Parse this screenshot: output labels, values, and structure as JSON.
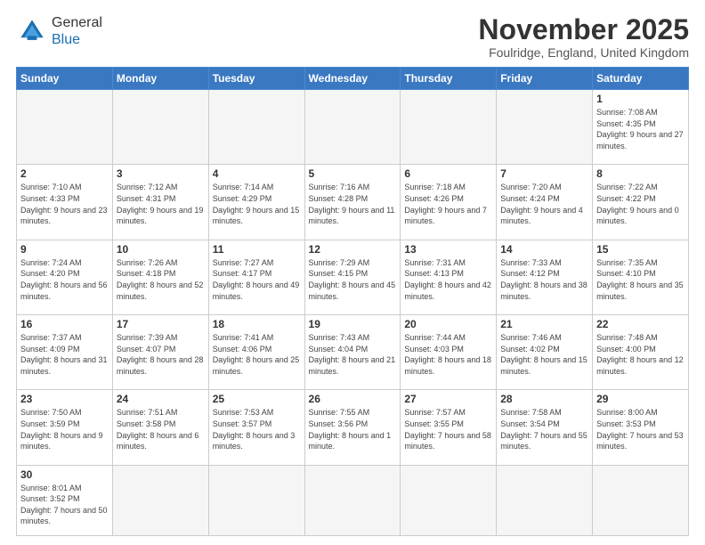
{
  "header": {
    "logo_line1": "General",
    "logo_line2": "Blue",
    "month_title": "November 2025",
    "location": "Foulridge, England, United Kingdom"
  },
  "days_of_week": [
    "Sunday",
    "Monday",
    "Tuesday",
    "Wednesday",
    "Thursday",
    "Friday",
    "Saturday"
  ],
  "weeks": [
    {
      "days": [
        {
          "number": "",
          "info": ""
        },
        {
          "number": "",
          "info": ""
        },
        {
          "number": "",
          "info": ""
        },
        {
          "number": "",
          "info": ""
        },
        {
          "number": "",
          "info": ""
        },
        {
          "number": "",
          "info": ""
        },
        {
          "number": "1",
          "info": "Sunrise: 7:08 AM\nSunset: 4:35 PM\nDaylight: 9 hours\nand 27 minutes."
        }
      ]
    },
    {
      "days": [
        {
          "number": "2",
          "info": "Sunrise: 7:10 AM\nSunset: 4:33 PM\nDaylight: 9 hours\nand 23 minutes."
        },
        {
          "number": "3",
          "info": "Sunrise: 7:12 AM\nSunset: 4:31 PM\nDaylight: 9 hours\nand 19 minutes."
        },
        {
          "number": "4",
          "info": "Sunrise: 7:14 AM\nSunset: 4:29 PM\nDaylight: 9 hours\nand 15 minutes."
        },
        {
          "number": "5",
          "info": "Sunrise: 7:16 AM\nSunset: 4:28 PM\nDaylight: 9 hours\nand 11 minutes."
        },
        {
          "number": "6",
          "info": "Sunrise: 7:18 AM\nSunset: 4:26 PM\nDaylight: 9 hours\nand 7 minutes."
        },
        {
          "number": "7",
          "info": "Sunrise: 7:20 AM\nSunset: 4:24 PM\nDaylight: 9 hours\nand 4 minutes."
        },
        {
          "number": "8",
          "info": "Sunrise: 7:22 AM\nSunset: 4:22 PM\nDaylight: 9 hours\nand 0 minutes."
        }
      ]
    },
    {
      "days": [
        {
          "number": "9",
          "info": "Sunrise: 7:24 AM\nSunset: 4:20 PM\nDaylight: 8 hours\nand 56 minutes."
        },
        {
          "number": "10",
          "info": "Sunrise: 7:26 AM\nSunset: 4:18 PM\nDaylight: 8 hours\nand 52 minutes."
        },
        {
          "number": "11",
          "info": "Sunrise: 7:27 AM\nSunset: 4:17 PM\nDaylight: 8 hours\nand 49 minutes."
        },
        {
          "number": "12",
          "info": "Sunrise: 7:29 AM\nSunset: 4:15 PM\nDaylight: 8 hours\nand 45 minutes."
        },
        {
          "number": "13",
          "info": "Sunrise: 7:31 AM\nSunset: 4:13 PM\nDaylight: 8 hours\nand 42 minutes."
        },
        {
          "number": "14",
          "info": "Sunrise: 7:33 AM\nSunset: 4:12 PM\nDaylight: 8 hours\nand 38 minutes."
        },
        {
          "number": "15",
          "info": "Sunrise: 7:35 AM\nSunset: 4:10 PM\nDaylight: 8 hours\nand 35 minutes."
        }
      ]
    },
    {
      "days": [
        {
          "number": "16",
          "info": "Sunrise: 7:37 AM\nSunset: 4:09 PM\nDaylight: 8 hours\nand 31 minutes."
        },
        {
          "number": "17",
          "info": "Sunrise: 7:39 AM\nSunset: 4:07 PM\nDaylight: 8 hours\nand 28 minutes."
        },
        {
          "number": "18",
          "info": "Sunrise: 7:41 AM\nSunset: 4:06 PM\nDaylight: 8 hours\nand 25 minutes."
        },
        {
          "number": "19",
          "info": "Sunrise: 7:43 AM\nSunset: 4:04 PM\nDaylight: 8 hours\nand 21 minutes."
        },
        {
          "number": "20",
          "info": "Sunrise: 7:44 AM\nSunset: 4:03 PM\nDaylight: 8 hours\nand 18 minutes."
        },
        {
          "number": "21",
          "info": "Sunrise: 7:46 AM\nSunset: 4:02 PM\nDaylight: 8 hours\nand 15 minutes."
        },
        {
          "number": "22",
          "info": "Sunrise: 7:48 AM\nSunset: 4:00 PM\nDaylight: 8 hours\nand 12 minutes."
        }
      ]
    },
    {
      "days": [
        {
          "number": "23",
          "info": "Sunrise: 7:50 AM\nSunset: 3:59 PM\nDaylight: 8 hours\nand 9 minutes."
        },
        {
          "number": "24",
          "info": "Sunrise: 7:51 AM\nSunset: 3:58 PM\nDaylight: 8 hours\nand 6 minutes."
        },
        {
          "number": "25",
          "info": "Sunrise: 7:53 AM\nSunset: 3:57 PM\nDaylight: 8 hours\nand 3 minutes."
        },
        {
          "number": "26",
          "info": "Sunrise: 7:55 AM\nSunset: 3:56 PM\nDaylight: 8 hours\nand 1 minute."
        },
        {
          "number": "27",
          "info": "Sunrise: 7:57 AM\nSunset: 3:55 PM\nDaylight: 7 hours\nand 58 minutes."
        },
        {
          "number": "28",
          "info": "Sunrise: 7:58 AM\nSunset: 3:54 PM\nDaylight: 7 hours\nand 55 minutes."
        },
        {
          "number": "29",
          "info": "Sunrise: 8:00 AM\nSunset: 3:53 PM\nDaylight: 7 hours\nand 53 minutes."
        }
      ]
    },
    {
      "days": [
        {
          "number": "30",
          "info": "Sunrise: 8:01 AM\nSunset: 3:52 PM\nDaylight: 7 hours\nand 50 minutes."
        },
        {
          "number": "",
          "info": ""
        },
        {
          "number": "",
          "info": ""
        },
        {
          "number": "",
          "info": ""
        },
        {
          "number": "",
          "info": ""
        },
        {
          "number": "",
          "info": ""
        },
        {
          "number": "",
          "info": ""
        }
      ]
    }
  ]
}
